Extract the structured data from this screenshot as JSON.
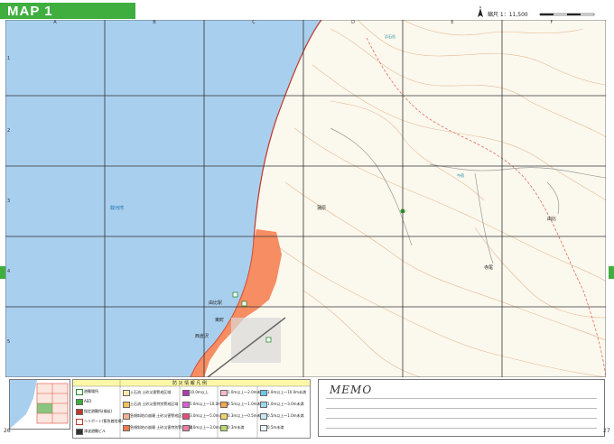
{
  "header": {
    "title": "MAP 1",
    "scale_label": "縮尺 1：11,500",
    "north_label": "N"
  },
  "grid": {
    "columns": [
      "A",
      "B",
      "C",
      "D",
      "E",
      "F"
    ],
    "rows": [
      "1",
      "2",
      "3",
      "4",
      "5"
    ]
  },
  "map_labels": {
    "sea": "駿河湾",
    "area1": "蒲原",
    "area2": "由比",
    "station": "由比駅",
    "town1": "東町",
    "town2": "西倉沢",
    "place1": "浜石岳",
    "place2": "今宿",
    "place3": "寺尾"
  },
  "legend": {
    "title": "防 災 情 報 凡 例",
    "col1": [
      "避難場所",
      "AED",
      "指定避難所(福祉)",
      "ヘリポート(緊急着陸場)",
      "津波避難ビル"
    ],
    "col2": [
      "土石流 土砂災害警戒区域",
      "土石流 土砂災害特別警戒区域",
      "急傾斜地の崩壊 土砂災害警戒区域",
      "急傾斜地の崩壊 土砂災害特別警戒区域"
    ],
    "col3": [
      "10.0m以上",
      "5.0m以上～10.0m未満",
      "3.0m以上～5.0m未満",
      "2.0m以上～3.0m未満"
    ],
    "col4": [
      "1.0m以上～2.0m未満",
      "0.5m以上～1.0m未満",
      "0.3m以上～0.5m未満",
      "0.3m未満"
    ],
    "col5": [
      "3.0m以上～10.0m未満",
      "1.0m以上～3.0m未満",
      "0.5m以上～1.0m未満",
      "0.5m未満"
    ]
  },
  "memo": {
    "title": "MEMO"
  },
  "pages": {
    "left": "26",
    "right": "27"
  },
  "colors": {
    "accent": "#3fae3f",
    "sea": "#a9cfee",
    "land": "#fbf8ee",
    "hazard": "#f47a4a"
  }
}
